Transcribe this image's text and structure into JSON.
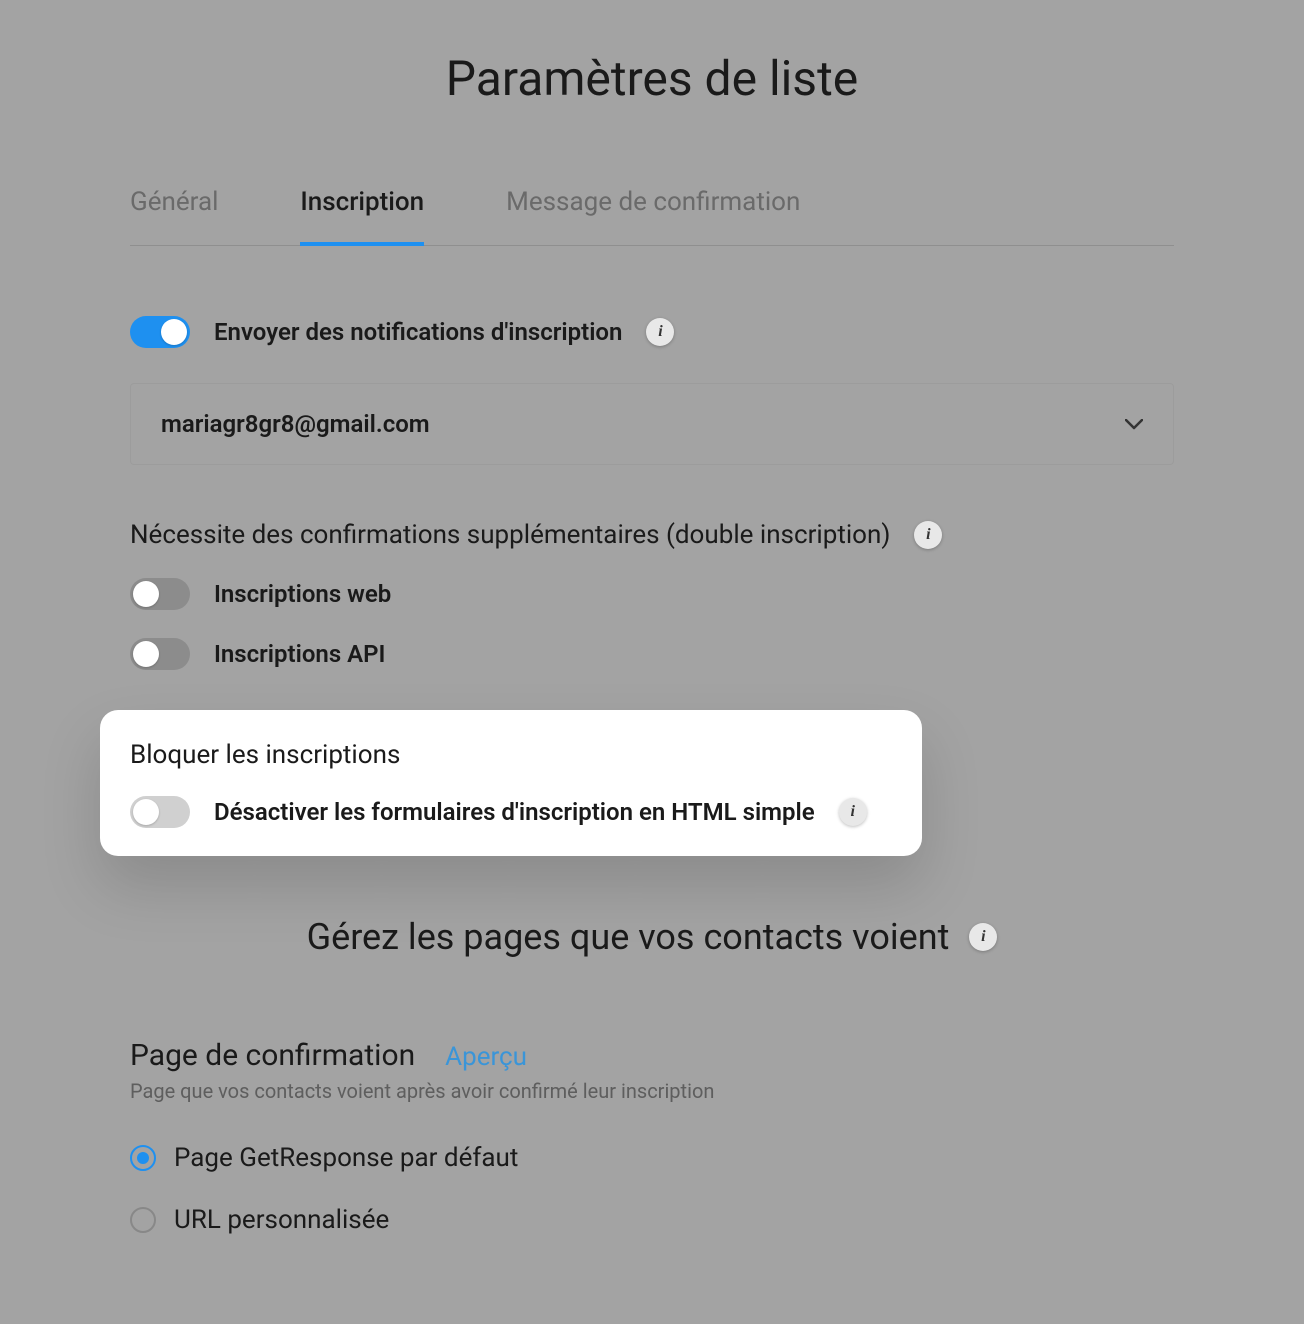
{
  "title": "Paramètres de liste",
  "tabs": {
    "general": "Général",
    "subscription": "Inscription",
    "confirmation_message": "Message de confirmation"
  },
  "notifications": {
    "label": "Envoyer des notifications d'inscription",
    "email": "mariagr8gr8@gmail.com"
  },
  "additional_confirmations": {
    "heading": "Nécessite des confirmations supplémentaires (double inscription)",
    "web": "Inscriptions web",
    "api": "Inscriptions API"
  },
  "block_subscriptions": {
    "heading": "Bloquer les inscriptions",
    "disable_html": "Désactiver les formulaires d'inscription en HTML simple"
  },
  "manage_pages": {
    "heading": "Gérez les pages que vos contacts voient"
  },
  "confirmation_page": {
    "title": "Page de confirmation",
    "preview": "Aperçu",
    "subtitle": "Page que vos contacts voient après avoir confirmé leur inscription",
    "option_default": "Page GetResponse par défaut",
    "option_custom": "URL personnalisée"
  }
}
